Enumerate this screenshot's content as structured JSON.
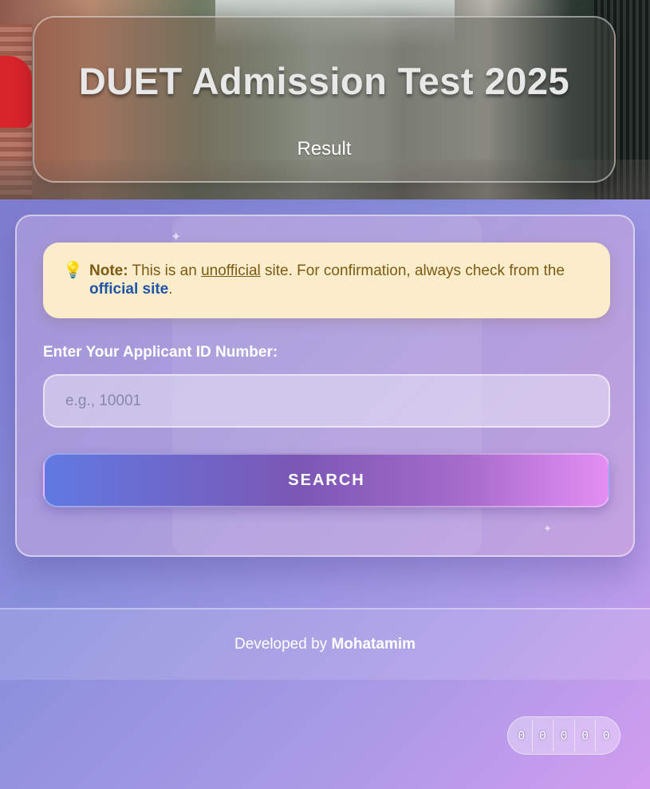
{
  "header": {
    "title": "DUET Admission Test 2025",
    "subtitle": "Result"
  },
  "note": {
    "icon": "lightbulb-icon",
    "label": "Note:",
    "text_before": " This is an ",
    "unofficial": "unofficial",
    "text_middle": " site. For confirmation, always check from the ",
    "link_text": "official site",
    "text_after": "."
  },
  "form": {
    "label": "Enter Your Applicant ID Number:",
    "placeholder": "e.g., 10001",
    "value": "",
    "button_label": "SEARCH"
  },
  "footer": {
    "prefix": "Developed by ",
    "author": "Mohatamim"
  },
  "counter": {
    "digits": [
      "0",
      "0",
      "0",
      "0",
      "0"
    ]
  },
  "colors": {
    "note_bg": "#fbeccb",
    "note_text": "#7b5a12",
    "link": "#1f55a6",
    "button_start": "#6079e2",
    "button_end": "#e48ef3"
  }
}
